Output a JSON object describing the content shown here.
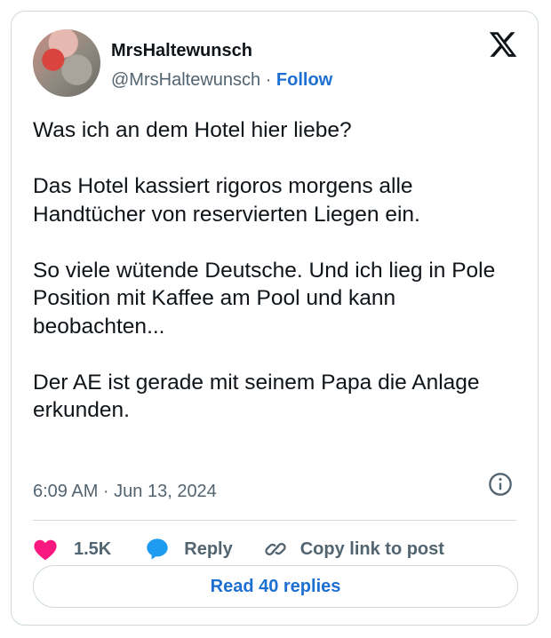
{
  "author": {
    "name": "MrsHaltewunsch",
    "handle": "@MrsHaltewunsch",
    "separator": "·",
    "follow_label": "Follow"
  },
  "tweet": {
    "paragraphs": [
      "Was ich an dem Hotel hier liebe?",
      "Das Hotel kassiert rigoros morgens alle Handtücher von reservierten Liegen ein.",
      "So viele wütende Deutsche. Und ich lieg in Pole Position mit Kaffee am Pool und kann beobachten...",
      "Der AE ist gerade mit seinem Papa die Anlage erkunden."
    ],
    "timestamp": "6:09 AM · Jun 13, 2024"
  },
  "actions": {
    "like_count": "1.5K",
    "reply_label": "Reply",
    "copy_link_label": "Copy link to post"
  },
  "read_replies_label": "Read 40 replies",
  "icons": {
    "platform_logo": "x-logo-icon",
    "info": "info-icon",
    "like": "heart-icon",
    "reply": "speech-bubble-icon",
    "copy_link": "link-icon"
  },
  "colors": {
    "text": "#0f1419",
    "secondary": "#536471",
    "link_blue": "#1d6fd1",
    "heart_pink": "#f91880",
    "reply_blue": "#1d9bf0",
    "border": "#cfd9de"
  }
}
